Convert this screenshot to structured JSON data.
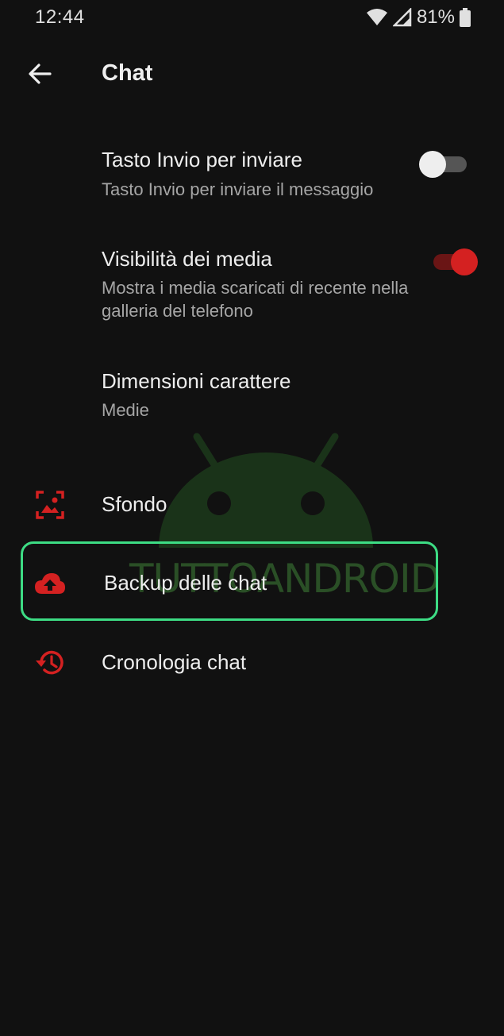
{
  "status_bar": {
    "time": "12:44",
    "battery": "81%",
    "icons": [
      "wifi-icon",
      "cellular-signal-icon",
      "battery-icon"
    ]
  },
  "app_bar": {
    "title": "Chat",
    "back_icon": "back-arrow-icon"
  },
  "settings": [
    {
      "title": "Tasto Invio per inviare",
      "subtitle": "Tasto Invio per inviare il messaggio",
      "toggle": false
    },
    {
      "title": "Visibilità dei media",
      "subtitle": "Mostra i media scaricati di recente nella galleria del telefono",
      "toggle": true
    },
    {
      "title": "Dimensioni carattere",
      "subtitle": "Medie"
    }
  ],
  "menu_items": [
    {
      "label": "Sfondo",
      "icon": "wallpaper-icon"
    },
    {
      "label": "Backup delle chat",
      "icon": "cloud-upload-icon",
      "highlighted": true
    },
    {
      "label": "Cronologia chat",
      "icon": "history-icon"
    }
  ],
  "watermark": {
    "text": "TUTTOANDROID"
  },
  "colors": {
    "background": "#111111",
    "accent_red": "#d42121",
    "highlight_green": "#3ddc84"
  }
}
